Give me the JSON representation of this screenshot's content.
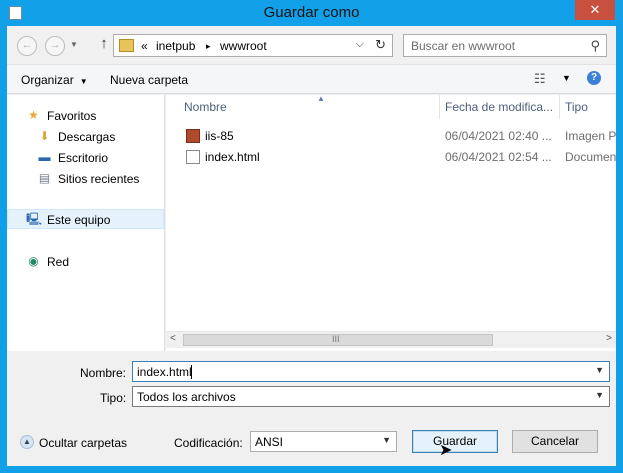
{
  "window": {
    "title": "Guardar como",
    "close_glyph": "✕"
  },
  "address": {
    "overflow": "«",
    "segments": [
      "inetpub",
      "wwwroot"
    ],
    "separator": "▸",
    "dropdown_glyph": "⌵",
    "refresh_glyph": "↻"
  },
  "nav": {
    "back_glyph": "←",
    "forward_glyph": "→",
    "up_glyph": "↑"
  },
  "search": {
    "placeholder": "Buscar en wwwroot",
    "icon_glyph": "⚲"
  },
  "toolbar": {
    "organize_label": "Organizar",
    "new_folder_label": "Nueva carpeta",
    "view_glyph": "☷",
    "view_dd_glyph": "▼",
    "help_glyph": "?",
    "arrow_glyph": "▼"
  },
  "navpane": {
    "items": [
      {
        "label": "Favoritos",
        "icon": "star-icon",
        "glyph": "★",
        "color": "#e8a93a"
      },
      {
        "label": "Descargas",
        "icon": "downloads-icon",
        "glyph": "⬇",
        "color": "#d9a53a"
      },
      {
        "label": "Escritorio",
        "icon": "desktop-icon",
        "glyph": "▬",
        "color": "#2a66b0"
      },
      {
        "label": "Sitios recientes",
        "icon": "recent-places-icon",
        "glyph": "▤",
        "color": "#6f7d8c"
      },
      {
        "label": "Este equipo",
        "icon": "computer-icon",
        "glyph": "🖳",
        "color": "#2a66b0"
      },
      {
        "label": "Red",
        "icon": "network-icon",
        "glyph": "◉",
        "color": "#1f8a6a"
      }
    ]
  },
  "columns": {
    "name": "Nombre",
    "date": "Fecha de modifica...",
    "type": "Tipo",
    "sort_glyph": "▲"
  },
  "files": [
    {
      "name": "iis-85",
      "date": "06/04/2021 02:40 ...",
      "type": "Imagen P",
      "icon": "image-file-icon"
    },
    {
      "name": "index.html",
      "date": "06/04/2021 02:54 ...",
      "type": "Documen",
      "icon": "html-file-icon"
    }
  ],
  "hscroll": {
    "left_glyph": "<",
    "right_glyph": ">",
    "grip_glyph": "III"
  },
  "form": {
    "filename_label": "Nombre:",
    "filename_value": "index.html",
    "type_label": "Tipo:",
    "type_value": "Todos los archivos",
    "encoding_label": "Codificación:",
    "encoding_value": "ANSI",
    "dd_glyph": "▼"
  },
  "buttons": {
    "hide_folders": "Ocultar carpetas",
    "hide_glyph": "▲",
    "save": "Guardar",
    "cancel": "Cancelar"
  },
  "colors": {
    "title_bar": "#12a1e9",
    "close_button": "#c7503f",
    "selection": "#e5f1fb"
  }
}
